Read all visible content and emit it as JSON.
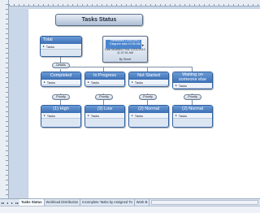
{
  "diagram": {
    "title": "Tasks Status",
    "total_node": {
      "label": "Total",
      "row_label": "Tasks"
    },
    "info_box": {
      "line1": "Refreshed 12/01/2013",
      "line2": "Diagram data 10:36 AM",
      "line3": "Last Modified Time 12/01/2013",
      "line4": "11:37:01 AM",
      "line5": "By Sheet"
    },
    "details_label": "Details",
    "status_nodes": [
      {
        "label": "Completed",
        "row_label": "Tasks"
      },
      {
        "label": "In Progress",
        "row_label": "Tasks"
      },
      {
        "label": "Not Started",
        "row_label": "Tasks"
      },
      {
        "label": "Waiting on someone else",
        "row_label": "Tasks"
      }
    ],
    "priority_nodes": [
      {
        "label": "(1) High",
        "row_label": "Tasks"
      },
      {
        "label": "(3) Low",
        "row_label": "Tasks"
      },
      {
        "label": "(2) Normal",
        "row_label": "Tasks"
      },
      {
        "label": "(2) Normal",
        "row_label": "Tasks"
      }
    ],
    "priority_pill_label": "Priority"
  },
  "tabs": [
    {
      "label": "Tasks Status",
      "active": true
    },
    {
      "label": "Workload Distribution",
      "active": false
    },
    {
      "label": "Incomplete Tasks by Assigned To",
      "active": false
    },
    {
      "label": "Work B",
      "active": false
    }
  ],
  "icons": {
    "nav_first": "first-page-icon",
    "nav_prev": "previous-page-icon",
    "nav_next": "next-page-icon",
    "nav_last": "last-page-icon",
    "row_expand": "triangle-icon"
  },
  "colors": {
    "node_header": "#3b6fb5",
    "node_body": "#dce6f3",
    "canvas_bg": "#c9d7e8"
  }
}
